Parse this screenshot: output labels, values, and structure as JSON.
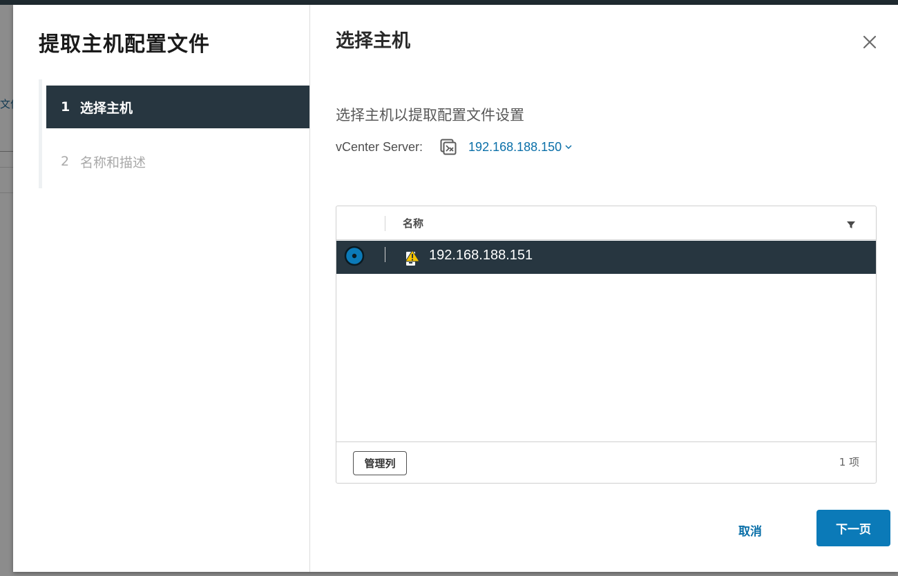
{
  "background": {
    "fragment_text": "文件"
  },
  "wizard": {
    "title": "提取主机配置文件",
    "steps": [
      {
        "number": "1",
        "label": "选择主机",
        "state": "active"
      },
      {
        "number": "2",
        "label": "名称和描述",
        "state": "inactive"
      }
    ]
  },
  "page": {
    "title": "选择主机",
    "instruction": "选择主机以提取配置文件设置",
    "vcenter_label": "vCenter Server:",
    "vcenter_value": "192.168.188.150"
  },
  "grid": {
    "column_name": "名称",
    "rows": [
      {
        "name": "192.168.188.151",
        "selected": true,
        "icon": "host-warning-icon"
      }
    ],
    "manage_columns_label": "管理列",
    "item_count": "1 项"
  },
  "footer": {
    "cancel_label": "取消",
    "next_label": "下一页"
  },
  "colors": {
    "active_step_bg": "#273640",
    "link_blue": "#0a6fa8",
    "primary_button": "#0b7ab8",
    "warning_yellow": "#f5c400"
  }
}
